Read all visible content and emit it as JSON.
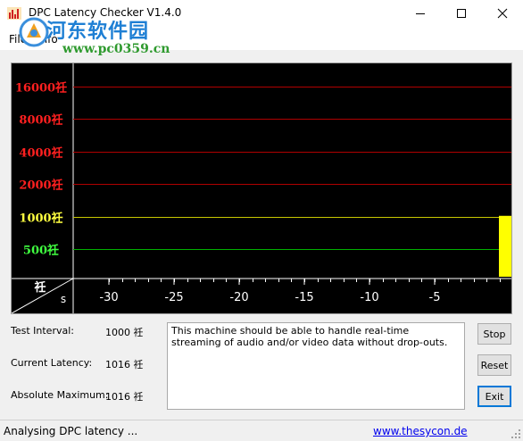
{
  "window": {
    "title": "DPC Latency Checker V1.4.0"
  },
  "menu": {
    "items": [
      {
        "label": "File"
      },
      {
        "label": "Info"
      }
    ]
  },
  "watermark": {
    "text": "河东软件园",
    "url": "www.pc0359.cn"
  },
  "graph": {
    "unit": "祍",
    "corner_top": "祍",
    "corner_bottom": "s",
    "levels": [
      {
        "label": "16000祍",
        "value": 16000,
        "color": "#ff2020"
      },
      {
        "label": "8000祍",
        "value": 8000,
        "color": "#ff2020"
      },
      {
        "label": "4000祍",
        "value": 4000,
        "color": "#ff2020"
      },
      {
        "label": "2000祍",
        "value": 2000,
        "color": "#ff2020"
      },
      {
        "label": "1000祍",
        "value": 1000,
        "color": "#ffff40"
      },
      {
        "label": "500祍",
        "value": 500,
        "color": "#40ff40"
      }
    ],
    "line_colors": {
      "red": "#b00000",
      "yellow": "#c8c800",
      "green": "#00b000"
    },
    "x_ticks": [
      {
        "label": "-30",
        "value": -30
      },
      {
        "label": "-25",
        "value": -25
      },
      {
        "label": "-20",
        "value": -20
      },
      {
        "label": "-15",
        "value": -15
      },
      {
        "label": "-10",
        "value": -10
      },
      {
        "label": "-5",
        "value": -5
      }
    ],
    "bars": [
      {
        "time": 0,
        "latency": 1016,
        "color": "#ffff00"
      }
    ]
  },
  "info": {
    "test_interval": {
      "label": "Test Interval:",
      "value": "1000 祍"
    },
    "current_latency": {
      "label": "Current Latency:",
      "value": "1016 祍"
    },
    "absolute_maximum": {
      "label": "Absolute Maximum:",
      "value": "1016 祍"
    }
  },
  "message": "This machine should be able to handle real-time streaming of audio and/or video data without drop-outs.",
  "buttons": {
    "stop": "Stop",
    "reset": "Reset",
    "exit": "Exit"
  },
  "status": {
    "text": "Analysing DPC latency ...",
    "link": "www.thesycon.de"
  }
}
